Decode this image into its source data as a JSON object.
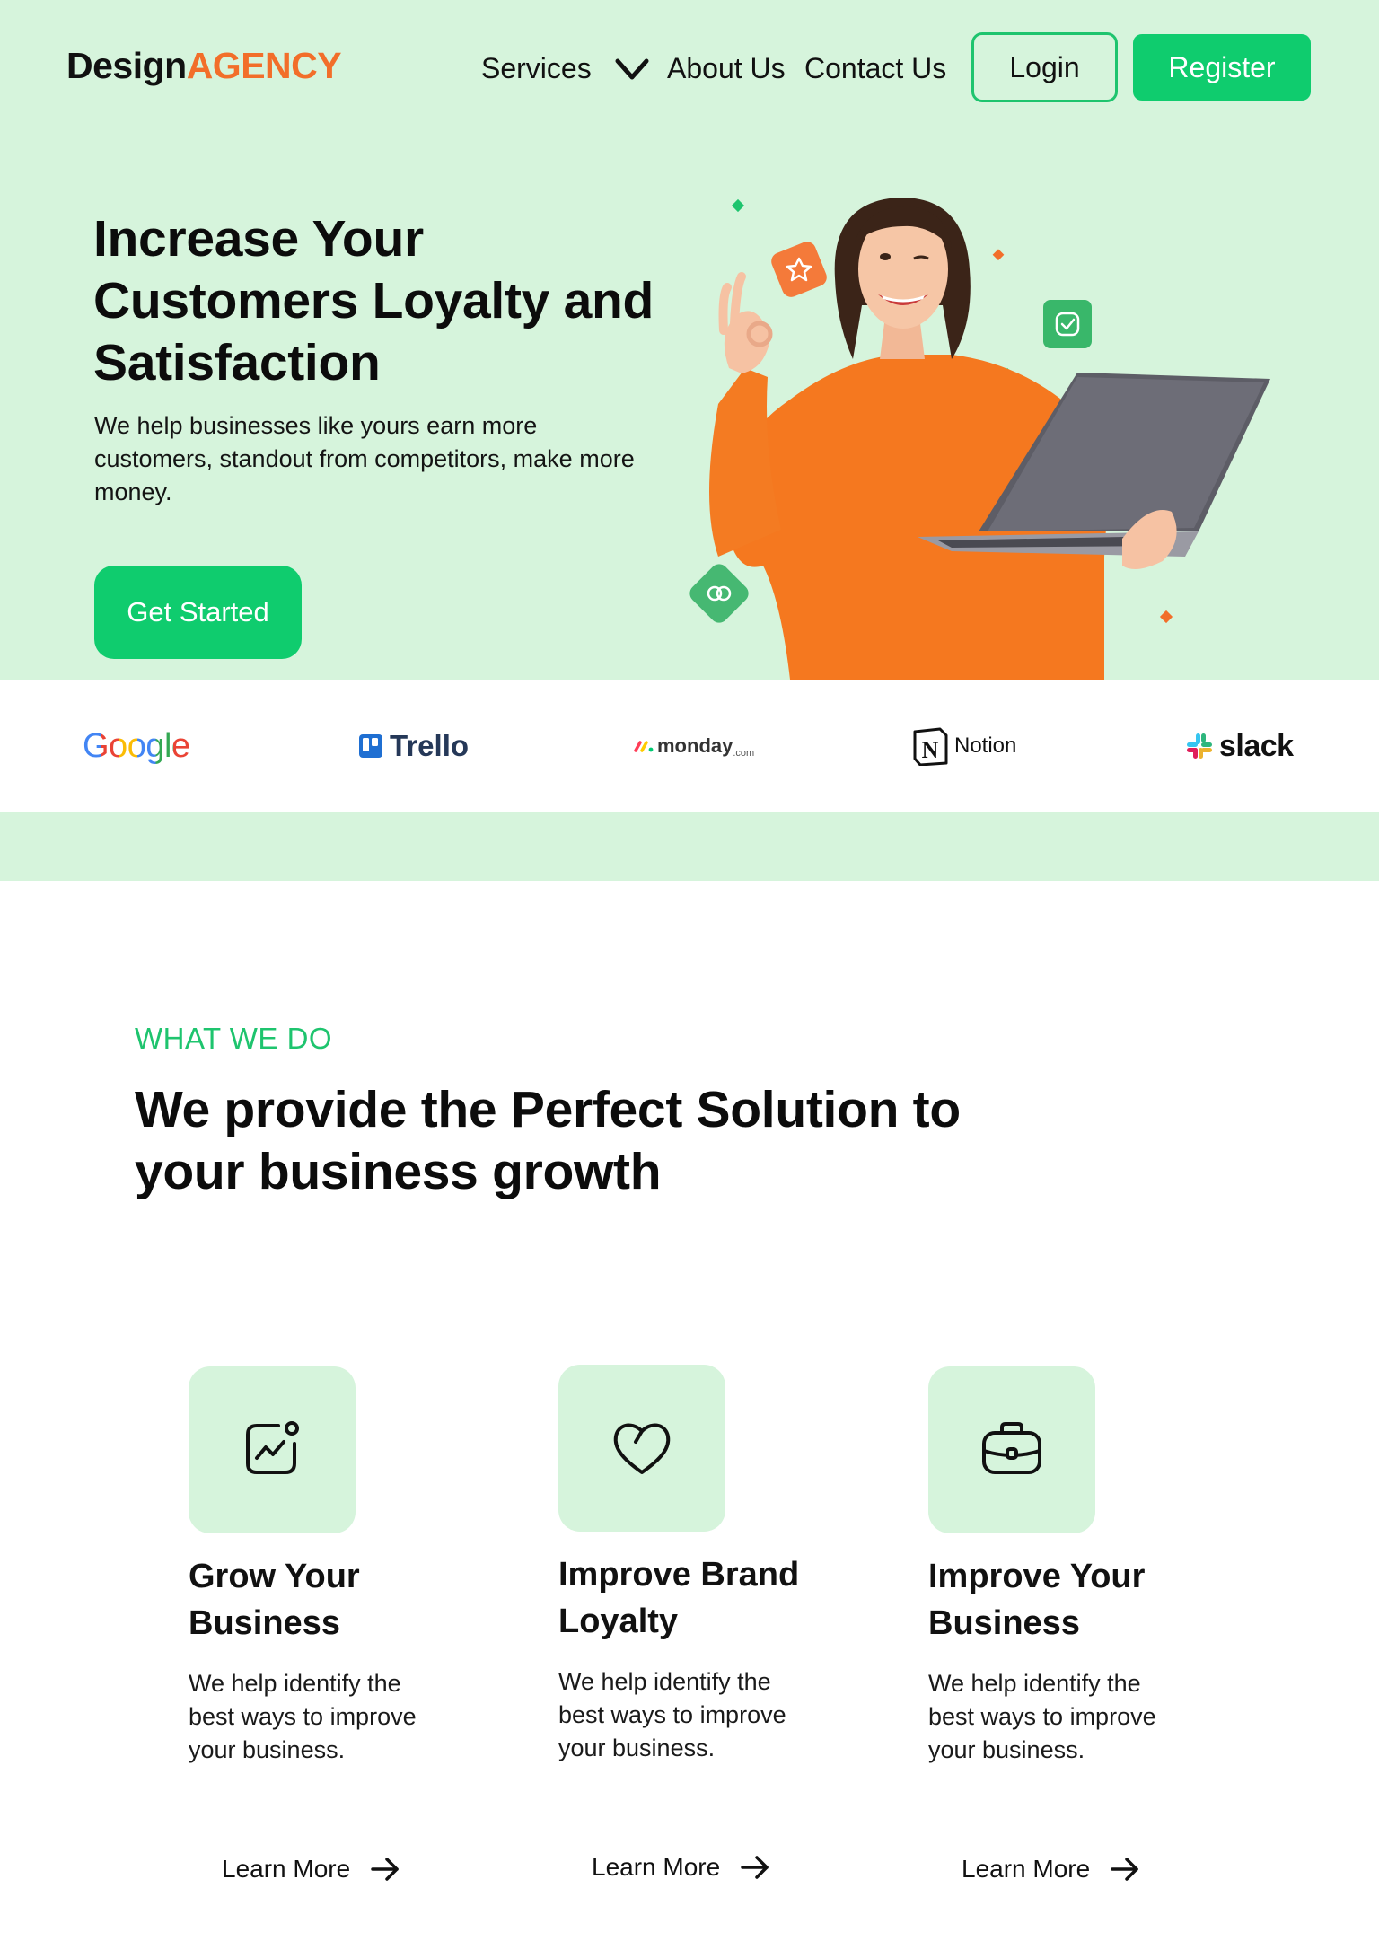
{
  "header": {
    "logo_part1": "Design",
    "logo_part2": "AGENCY",
    "nav": {
      "services": "Services",
      "about": "About Us",
      "contact": "Contact Us"
    },
    "login_label": "Login",
    "register_label": "Register"
  },
  "hero": {
    "title": "Increase Your Customers Loyalty and Satisfaction",
    "subtitle": "We help businesses like yours earn more customers, standout from competitors, make more money.",
    "cta_label": "Get Started"
  },
  "brands": {
    "google": "Google",
    "trello": "Trello",
    "monday": "monday",
    "monday_suffix": ".com",
    "notion": "Notion",
    "slack": "slack"
  },
  "section": {
    "eyebrow": "WHAT WE DO",
    "title": "We provide the Perfect Solution to your business growth"
  },
  "cards": [
    {
      "icon": "growth-chart-icon",
      "title": "Grow Your Business",
      "text": "We help identify the best ways to improve your business.",
      "link": "Learn More"
    },
    {
      "icon": "heart-icon",
      "title": "Improve Brand Loyalty",
      "text": "We help identify the best ways to improve your business.",
      "link": "Learn More"
    },
    {
      "icon": "briefcase-icon",
      "title": "Improve Your Business",
      "text": "We help identify the best ways to improve your business.",
      "link": "Learn More"
    }
  ],
  "colors": {
    "accent_green": "#0fcc6e",
    "light_green_bg": "#d6f4dc",
    "brand_orange": "#f26e2a"
  }
}
